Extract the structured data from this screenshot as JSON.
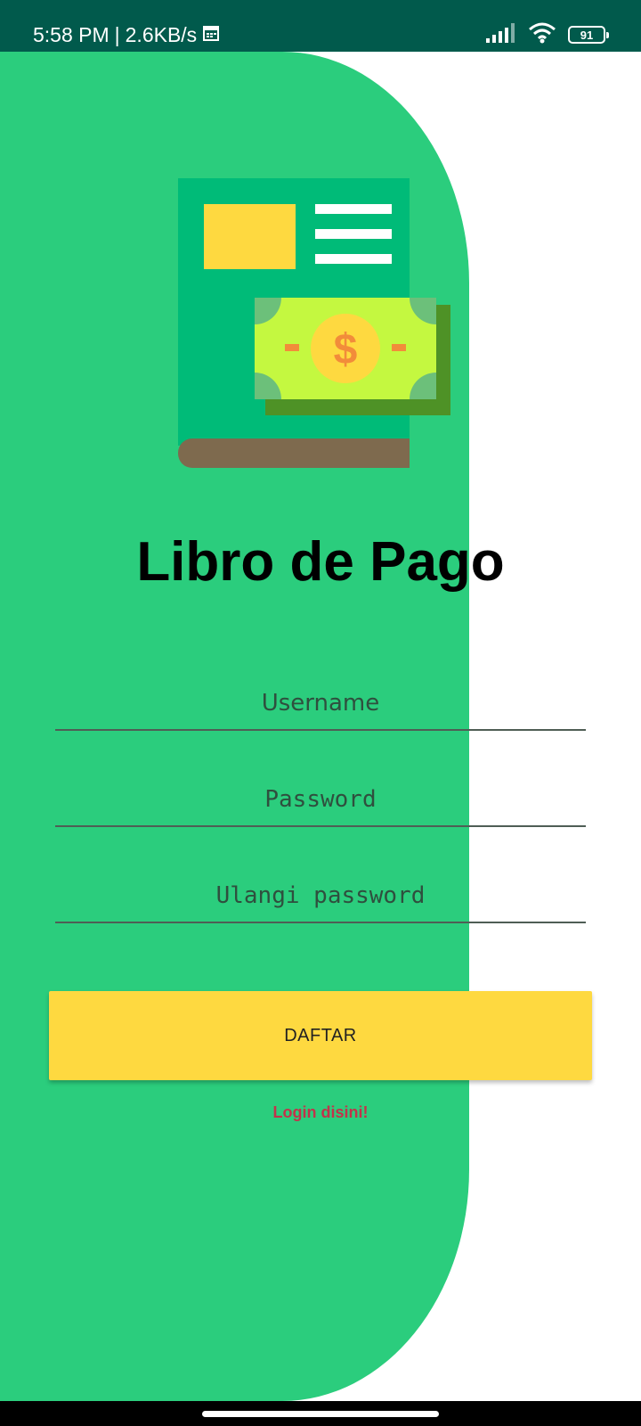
{
  "status_bar": {
    "time": "5:58 PM",
    "separator": "|",
    "network_speed": "2.6KB/s",
    "battery_level": "91",
    "icons": [
      "calendar-icon",
      "signal-icon",
      "wifi-icon",
      "battery-icon"
    ]
  },
  "app": {
    "title": "Libro de Pago",
    "illustration_icon": "payment-book-icon"
  },
  "form": {
    "username_placeholder": "Username",
    "password_placeholder": "Password",
    "repeat_password_placeholder": "Ulangi password",
    "register_label": "DAFTAR",
    "login_link": "Login disini!"
  },
  "colors": {
    "status_bar": "#015a4c",
    "panel_green": "#2bcd7d",
    "book_green": "#00bb78",
    "accent_yellow": "#fed940",
    "link_red": "#c2334b",
    "money_lime": "#c4f840",
    "money_shadow": "#4e9226",
    "book_spine": "#7e6a4e"
  }
}
